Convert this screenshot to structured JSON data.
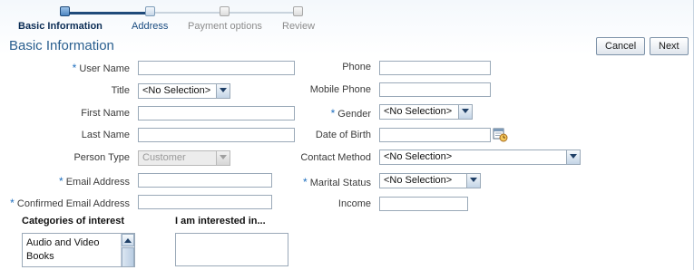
{
  "train": {
    "steps": [
      {
        "label": "Basic Information",
        "state": "current"
      },
      {
        "label": "Address",
        "state": "visited"
      },
      {
        "label": "Payment options",
        "state": "future"
      },
      {
        "label": "Review",
        "state": "future"
      }
    ]
  },
  "page_title": "Basic Information",
  "buttons": {
    "cancel": "Cancel",
    "next": "Next"
  },
  "required_marker": "*",
  "form_left": {
    "user_name": {
      "label": "User Name",
      "required": true,
      "value": ""
    },
    "title": {
      "label": "Title",
      "value": "<No Selection>"
    },
    "first_name": {
      "label": "First Name",
      "value": ""
    },
    "last_name": {
      "label": "Last Name",
      "value": ""
    },
    "person_type": {
      "label": "Person Type",
      "value": "Customer",
      "disabled": true
    },
    "email": {
      "label": "Email Address",
      "required": true,
      "value": ""
    },
    "confirm_email": {
      "label": "Confirmed Email Address",
      "required": true,
      "value": ""
    }
  },
  "form_right": {
    "phone": {
      "label": "Phone",
      "value": ""
    },
    "mobile_phone": {
      "label": "Mobile Phone",
      "value": ""
    },
    "gender": {
      "label": "Gender",
      "required": true,
      "value": "<No Selection>"
    },
    "date_of_birth": {
      "label": "Date of Birth",
      "value": ""
    },
    "contact_method": {
      "label": "Contact Method",
      "value": "<No Selection>"
    },
    "marital_status": {
      "label": "Marital Status",
      "required": true,
      "value": "<No Selection>"
    },
    "income": {
      "label": "Income",
      "value": ""
    }
  },
  "categories": {
    "heading": "Categories of interest",
    "items": [
      "Audio and Video",
      "Books"
    ]
  },
  "interested": {
    "heading": "I am interested in..."
  },
  "icons": {
    "dropdown": "chevron-down-icon",
    "date_picker": "calendar-icon",
    "scroll_up": "arrow-up-icon"
  },
  "colors": {
    "title": "#2a5f8f",
    "required": "#1f6fbf",
    "train_active": "#1f4a7a"
  }
}
